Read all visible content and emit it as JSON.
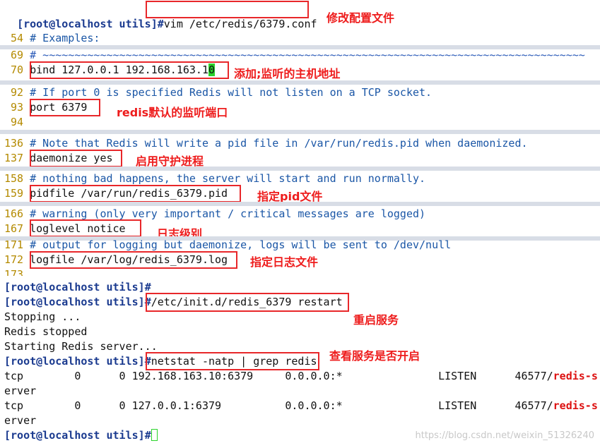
{
  "terminal": {
    "prompt": "[root@localhost utils]",
    "hash": "#",
    "cmd_vim": "vim /etc/redis/6379.conf",
    "anno_vim": "修改配置文件",
    "cfg": [
      {
        "ln": " 54",
        "text": "# Examples:"
      },
      {
        "ln": " 69",
        "text": "# ~~~~~~~~~~~~~~~~~~~~~~~~~~~~~~~~~~~~~~~~~~~~~~~~~~~~~~~~~~~~~~~~~~~~~~~~~~~~~~~~~~~~~"
      },
      {
        "ln": " 70",
        "text": "bind 127.0.0.1 192.168.163.1",
        "cursor_char": "0"
      },
      {
        "ln": " 92",
        "text": "# If port 0 is specified Redis will not listen on a TCP socket."
      },
      {
        "ln": " 93",
        "text": "port 6379"
      },
      {
        "ln": " 94",
        "text": ""
      },
      {
        "ln": "136",
        "text": "# Note that Redis will write a pid file in /var/run/redis.pid when daemonized."
      },
      {
        "ln": "137",
        "text": "daemonize yes"
      },
      {
        "ln": "158",
        "text": "# nothing bad happens, the server will start and run normally."
      },
      {
        "ln": "159",
        "text": "pidfile /var/run/redis_6379.pid"
      },
      {
        "ln": "166",
        "text": "# warning (only very important / critical messages are logged)"
      },
      {
        "ln": "167",
        "text": "loglevel notice"
      },
      {
        "ln": "171",
        "text": "# output for logging but daemonize, logs will be sent to /dev/null"
      },
      {
        "ln": "172",
        "text": "logfile /var/log/redis_6379.log"
      },
      {
        "ln": "173",
        "text": ""
      }
    ],
    "anno_bind": "添加;监听的主机地址",
    "anno_port": "redis默认的监听端口",
    "anno_daemon": "启用守护进程",
    "anno_pid": "指定pid文件",
    "anno_loglevel": "日志级别",
    "anno_logfile": "指定日志文件",
    "cmd_restart": "/etc/init.d/redis_6379 restart",
    "anno_restart": "重启服务",
    "out_stopping": "Stopping ...",
    "out_stopped": "Redis stopped",
    "out_starting": "Starting Redis server...",
    "cmd_netstat": "netstat -natp | grep redis",
    "anno_netstat": "查看服务是否开启",
    "netstat_rows": [
      {
        "pre": "tcp        0      0 192.168.163.10:6379     0.0.0.0:*               LISTEN      46577/",
        "proc": "redis-s",
        "wrap": "erver"
      },
      {
        "pre": "tcp        0      0 127.0.0.1:6379          0.0.0.0:*               LISTEN      46577/",
        "proc": "redis-s",
        "wrap": "erver"
      }
    ],
    "watermark": "https://blog.csdn.net/weixin_51326240"
  }
}
